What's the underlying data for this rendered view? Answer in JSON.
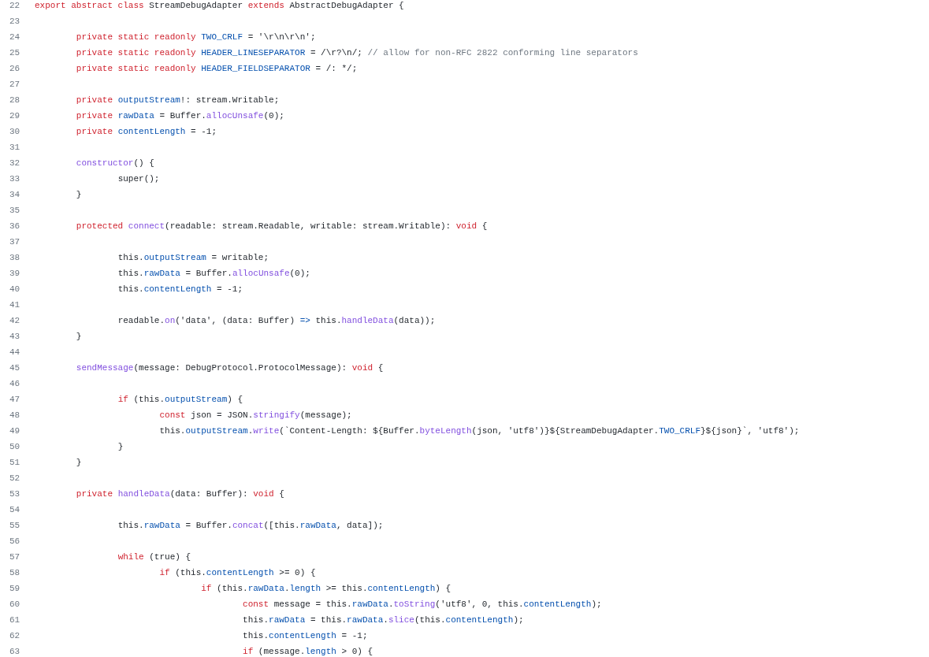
{
  "code_lines": [
    {
      "number": "22",
      "tokens": [
        {
          "kind": "keyword",
          "text": "export abstract class"
        },
        {
          "kind": "plain",
          "text": " StreamDebugAdapter "
        },
        {
          "kind": "keyword",
          "text": "extends"
        },
        {
          "kind": "plain",
          "text": " AbstractDebugAdapter {"
        }
      ]
    },
    {
      "number": "23"
    },
    {
      "number": "24",
      "tokens": [
        {
          "kind": "keyword",
          "text": "\tprivate static readonly "
        },
        {
          "kind": "property",
          "text": "TWO_CRLF"
        },
        {
          "kind": "plain",
          "text": " = '\\r\\n\\r\\n';"
        }
      ]
    },
    {
      "number": "25",
      "tokens": [
        {
          "kind": "keyword",
          "text": "\tprivate static readonly "
        },
        {
          "kind": "property",
          "text": "HEADER_LINESEPARATOR"
        },
        {
          "kind": "plain",
          "text": " = /\\r?\\n/; "
        },
        {
          "kind": "comment",
          "text": "// allow for non-RFC 2822 conforming line separators"
        }
      ]
    },
    {
      "number": "26",
      "tokens": [
        {
          "kind": "keyword",
          "text": "\tprivate static readonly "
        },
        {
          "kind": "property",
          "text": "HEADER_FIELDSEPARATOR"
        },
        {
          "kind": "plain",
          "text": " = /: */;"
        }
      ]
    },
    {
      "number": "27"
    },
    {
      "number": "28",
      "tokens": [
        {
          "kind": "keyword",
          "text": "\tprivate "
        },
        {
          "kind": "property",
          "text": "outputStream"
        },
        {
          "kind": "plain",
          "text": "!: stream.Writable;"
        }
      ]
    },
    {
      "number": "29",
      "tokens": [
        {
          "kind": "keyword",
          "text": "\tprivate "
        },
        {
          "kind": "property",
          "text": "rawData"
        },
        {
          "kind": "plain",
          "text": " = Buffer."
        },
        {
          "kind": "function",
          "text": "allocUnsafe"
        },
        {
          "kind": "plain",
          "text": "(0);"
        }
      ]
    },
    {
      "number": "30",
      "tokens": [
        {
          "kind": "keyword",
          "text": "\tprivate "
        },
        {
          "kind": "property",
          "text": "contentLength"
        },
        {
          "kind": "plain",
          "text": " = -1;"
        }
      ]
    },
    {
      "number": "31"
    },
    {
      "number": "32",
      "tokens": [
        {
          "kind": "function",
          "text": "\tconstructor"
        },
        {
          "kind": "plain",
          "text": "() {"
        }
      ]
    },
    {
      "number": "33",
      "tokens": [
        {
          "kind": "plain",
          "text": "\t\tsuper();"
        }
      ]
    },
    {
      "number": "34",
      "tokens": [
        {
          "kind": "plain",
          "text": "\t}"
        }
      ]
    },
    {
      "number": "35"
    },
    {
      "number": "36",
      "tokens": [
        {
          "kind": "keyword",
          "text": "\tprotected "
        },
        {
          "kind": "function",
          "text": "connect"
        },
        {
          "kind": "plain",
          "text": "(readable: stream.Readable, writable: stream.Writable): "
        },
        {
          "kind": "keyword",
          "text": "void"
        },
        {
          "kind": "plain",
          "text": " {"
        }
      ]
    },
    {
      "number": "37"
    },
    {
      "number": "38",
      "tokens": [
        {
          "kind": "plain",
          "text": "\t\tthis."
        },
        {
          "kind": "property",
          "text": "outputStream"
        },
        {
          "kind": "plain",
          "text": " = writable;"
        }
      ]
    },
    {
      "number": "39",
      "tokens": [
        {
          "kind": "plain",
          "text": "\t\tthis."
        },
        {
          "kind": "property",
          "text": "rawData"
        },
        {
          "kind": "plain",
          "text": " = Buffer."
        },
        {
          "kind": "function",
          "text": "allocUnsafe"
        },
        {
          "kind": "plain",
          "text": "(0);"
        }
      ]
    },
    {
      "number": "40",
      "tokens": [
        {
          "kind": "plain",
          "text": "\t\tthis."
        },
        {
          "kind": "property",
          "text": "contentLength"
        },
        {
          "kind": "plain",
          "text": " = -1;"
        }
      ]
    },
    {
      "number": "41"
    },
    {
      "number": "42",
      "tokens": [
        {
          "kind": "plain",
          "text": "\t\treadable."
        },
        {
          "kind": "function",
          "text": "on"
        },
        {
          "kind": "plain",
          "text": "('data', (data: Buffer) "
        },
        {
          "kind": "property",
          "text": "=>"
        },
        {
          "kind": "plain",
          "text": " this."
        },
        {
          "kind": "function",
          "text": "handleData"
        },
        {
          "kind": "plain",
          "text": "(data));"
        }
      ]
    },
    {
      "number": "43",
      "tokens": [
        {
          "kind": "plain",
          "text": "\t}"
        }
      ]
    },
    {
      "number": "44"
    },
    {
      "number": "45",
      "tokens": [
        {
          "kind": "function",
          "text": "\tsendMessage"
        },
        {
          "kind": "plain",
          "text": "(message: DebugProtocol.ProtocolMessage): "
        },
        {
          "kind": "keyword",
          "text": "void"
        },
        {
          "kind": "plain",
          "text": " {"
        }
      ]
    },
    {
      "number": "46"
    },
    {
      "number": "47",
      "tokens": [
        {
          "kind": "keyword",
          "text": "\t\tif"
        },
        {
          "kind": "plain",
          "text": " (this."
        },
        {
          "kind": "property",
          "text": "outputStream"
        },
        {
          "kind": "plain",
          "text": ") {"
        }
      ]
    },
    {
      "number": "48",
      "tokens": [
        {
          "kind": "keyword",
          "text": "\t\t\tconst"
        },
        {
          "kind": "plain",
          "text": " json = JSON."
        },
        {
          "kind": "function",
          "text": "stringify"
        },
        {
          "kind": "plain",
          "text": "(message);"
        }
      ]
    },
    {
      "number": "49",
      "tokens": [
        {
          "kind": "plain",
          "text": "\t\t\tthis."
        },
        {
          "kind": "property",
          "text": "outputStream"
        },
        {
          "kind": "plain",
          "text": "."
        },
        {
          "kind": "function",
          "text": "write"
        },
        {
          "kind": "plain",
          "text": "(`Content-Length: ${Buffer."
        },
        {
          "kind": "function",
          "text": "byteLength"
        },
        {
          "kind": "plain",
          "text": "(json, 'utf8')}${StreamDebugAdapter."
        },
        {
          "kind": "property",
          "text": "TWO_CRLF"
        },
        {
          "kind": "plain",
          "text": "}${json}`, 'utf8');"
        }
      ]
    },
    {
      "number": "50",
      "tokens": [
        {
          "kind": "plain",
          "text": "\t\t}"
        }
      ]
    },
    {
      "number": "51",
      "tokens": [
        {
          "kind": "plain",
          "text": "\t}"
        }
      ]
    },
    {
      "number": "52"
    },
    {
      "number": "53",
      "tokens": [
        {
          "kind": "keyword",
          "text": "\tprivate "
        },
        {
          "kind": "function",
          "text": "handleData"
        },
        {
          "kind": "plain",
          "text": "(data: Buffer): "
        },
        {
          "kind": "keyword",
          "text": "void"
        },
        {
          "kind": "plain",
          "text": " {"
        }
      ]
    },
    {
      "number": "54"
    },
    {
      "number": "55",
      "tokens": [
        {
          "kind": "plain",
          "text": "\t\tthis."
        },
        {
          "kind": "property",
          "text": "rawData"
        },
        {
          "kind": "plain",
          "text": " = Buffer."
        },
        {
          "kind": "function",
          "text": "concat"
        },
        {
          "kind": "plain",
          "text": "([this."
        },
        {
          "kind": "property",
          "text": "rawData"
        },
        {
          "kind": "plain",
          "text": ", data]);"
        }
      ]
    },
    {
      "number": "56"
    },
    {
      "number": "57",
      "tokens": [
        {
          "kind": "keyword",
          "text": "\t\twhile"
        },
        {
          "kind": "plain",
          "text": " (true) {"
        }
      ]
    },
    {
      "number": "58",
      "tokens": [
        {
          "kind": "keyword",
          "text": "\t\t\tif"
        },
        {
          "kind": "plain",
          "text": " (this."
        },
        {
          "kind": "property",
          "text": "contentLength"
        },
        {
          "kind": "plain",
          "text": " >= 0) {"
        }
      ]
    },
    {
      "number": "59",
      "tokens": [
        {
          "kind": "keyword",
          "text": "\t\t\t\tif"
        },
        {
          "kind": "plain",
          "text": " (this."
        },
        {
          "kind": "property",
          "text": "rawData"
        },
        {
          "kind": "plain",
          "text": "."
        },
        {
          "kind": "property",
          "text": "length"
        },
        {
          "kind": "plain",
          "text": " >= this."
        },
        {
          "kind": "property",
          "text": "contentLength"
        },
        {
          "kind": "plain",
          "text": ") {"
        }
      ]
    },
    {
      "number": "60",
      "tokens": [
        {
          "kind": "keyword",
          "text": "\t\t\t\t\tconst"
        },
        {
          "kind": "plain",
          "text": " message = this."
        },
        {
          "kind": "property",
          "text": "rawData"
        },
        {
          "kind": "plain",
          "text": "."
        },
        {
          "kind": "function",
          "text": "toString"
        },
        {
          "kind": "plain",
          "text": "('utf8', 0, this."
        },
        {
          "kind": "property",
          "text": "contentLength"
        },
        {
          "kind": "plain",
          "text": ");"
        }
      ]
    },
    {
      "number": "61",
      "tokens": [
        {
          "kind": "plain",
          "text": "\t\t\t\t\tthis."
        },
        {
          "kind": "property",
          "text": "rawData"
        },
        {
          "kind": "plain",
          "text": " = this."
        },
        {
          "kind": "property",
          "text": "rawData"
        },
        {
          "kind": "plain",
          "text": "."
        },
        {
          "kind": "function",
          "text": "slice"
        },
        {
          "kind": "plain",
          "text": "(this."
        },
        {
          "kind": "property",
          "text": "contentLength"
        },
        {
          "kind": "plain",
          "text": ");"
        }
      ]
    },
    {
      "number": "62",
      "tokens": [
        {
          "kind": "plain",
          "text": "\t\t\t\t\tthis."
        },
        {
          "kind": "property",
          "text": "contentLength"
        },
        {
          "kind": "plain",
          "text": " = -1;"
        }
      ]
    },
    {
      "number": "63",
      "tokens": [
        {
          "kind": "keyword",
          "text": "\t\t\t\t\tif"
        },
        {
          "kind": "plain",
          "text": " (message."
        },
        {
          "kind": "property",
          "text": "length"
        },
        {
          "kind": "plain",
          "text": " > 0) {"
        }
      ]
    }
  ]
}
